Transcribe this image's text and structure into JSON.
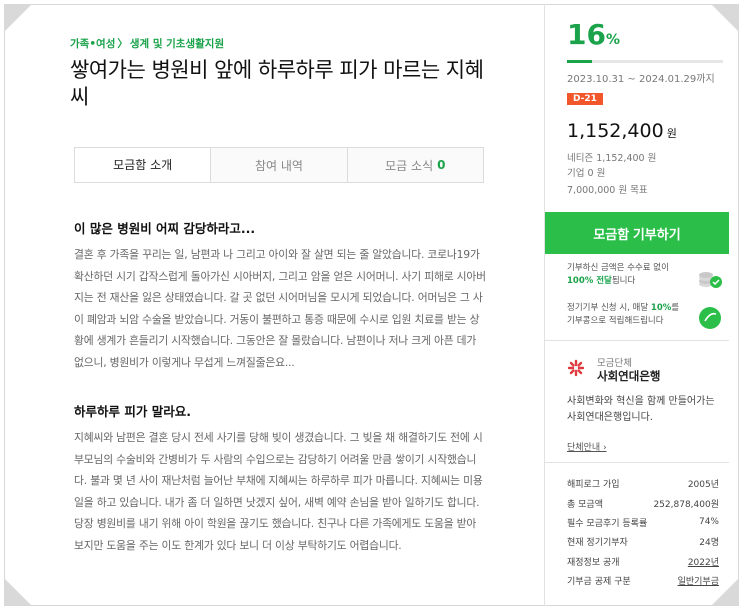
{
  "breadcrumb": {
    "category": "가족•여성",
    "separator": "〉",
    "subcategory": "생계 및 기초생활지원"
  },
  "title": "쌓여가는 병원비 앞에 하루하루 피가 마르는 지혜씨",
  "tabs": [
    {
      "label": "모금함 소개"
    },
    {
      "label": "참여 내역"
    },
    {
      "label": "모금 소식",
      "count": "0"
    }
  ],
  "story": {
    "heading1": "이 많은 병원비 어찌 감당하라고...",
    "paragraph1": "결혼 후 가족을 꾸리는 일, 남편과 나 그리고 아이와 잘 살면 되는 줄 알았습니다. 코로나19가 확산하던 시기 갑작스럽게 돌아가신 시아버지, 그리고 암을 얻은 시어머니. 사기 피해로 시아버지는 전 재산을 잃은 상태였습니다. 갈 곳 없던 시어머님을 모시게 되었습니다. 어머님은 그 사이 폐암과 뇌암 수술을 받았습니다. 거동이 불편하고 통증 때문에 수시로 입원 치료를 받는 상황에 생계가 흔들리기 시작했습니다. 그동안은 잘 몰랐습니다. 남편이나 저나 크게 아픈 데가 없으니, 병원비가 이렇게나 무섭게 느껴질줄은요...",
    "heading2": "하루하루 피가 말라요.",
    "paragraph2": "지혜씨와 남편은 결혼 당시 전세 사기를 당해 빚이 생겼습니다. 그 빚을 채 해결하기도 전에 시부모님의 수술비와 간병비가 두 사람의 수입으로는 감당하기 어려울 만큼 쌓이기 시작했습니다. 불과 몇 년 사이 재난처럼 늘어난 부채에 지혜씨는 하루하루 피가 마릅니다. 지혜씨는 미용 일을 하고 있습니다. 내가 좀 더 일하면 낫겠지 싶어, 새벽 예약 손님을 받아 일하기도 합니다. 당장 병원비를 내기 위해 아이 학원을 끊기도 했습니다. 친구나 다른 가족에게도 도움을 받아 보지만 도움을 주는 이도 한계가 있다 보니 더 이상 부탁하기도 어렵습니다."
  },
  "summary": {
    "percent": "16",
    "percent_unit": "%",
    "progress_fraction": 0.16,
    "period": "2023.10.31 ~ 2024.01.29까지",
    "dday": "D-21",
    "amount": "1,152,400",
    "amount_unit": "원",
    "netizen": "네티즌 1,152,400 원",
    "company": "기업 0 원",
    "goal": "7,000,000 원 목표"
  },
  "donate_button": "모금함 기부하기",
  "info1": {
    "text_a": "기부하신 금액은 수수료 없이",
    "highlight": "100% 전달",
    "text_b": "됩니다"
  },
  "info2": {
    "text_a": "정기기부 신청 시, 매달",
    "highlight": "10%",
    "text_b": "를 기부콩으로 적립해드립니다"
  },
  "org": {
    "kind": "모금단체",
    "name": "사회연대은행",
    "description": "사회변화와 혁신을 함께 만들어가는 사회연대은행입니다.",
    "link": "단체안내 ›"
  },
  "stats": [
    {
      "label": "해피로그 가입",
      "value": "2005년"
    },
    {
      "label": "총 모금액",
      "value": "252,878,400원"
    },
    {
      "label": "필수 모금후기 등록률",
      "value": "74%"
    },
    {
      "label": "현재 정기기부자",
      "value": "24명"
    },
    {
      "label": "재정정보 공개",
      "value": "2022년"
    },
    {
      "label": "기부금 공제 구분",
      "value": "일반기부금"
    }
  ],
  "colors": {
    "accent": "#1aa34a",
    "button": "#2bbf4a",
    "dday": "#f2572b"
  }
}
